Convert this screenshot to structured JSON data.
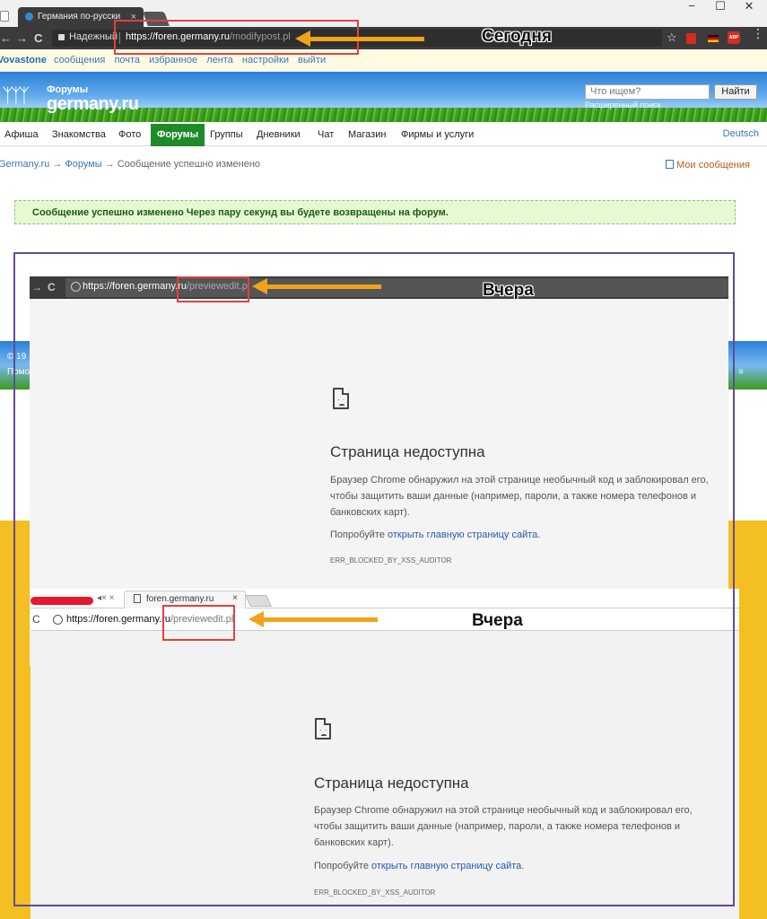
{
  "browser": {
    "tab_title": "Германия по-русски",
    "tab_close": "×",
    "win_controls": [
      "−",
      "☐",
      "✕"
    ],
    "nav": [
      "←",
      "→",
      "C"
    ],
    "secure_label": "Надежный",
    "url_host": "https://foren.germany.ru",
    "url_path": "/modifypost.pl",
    "star": "☆",
    "abp": "ABP",
    "menu": "⋮"
  },
  "site": {
    "username": "Vovastone",
    "userlinks": [
      "сообщения",
      "почта",
      "избранное",
      "лента",
      "настройки",
      "выйти"
    ],
    "logo_top": "Форумы",
    "logo_main": "germany.ru",
    "search_placeholder": "Что ищем?",
    "search_button": "Найти",
    "advanced_search": "Расширенный поиск",
    "nav": [
      "Афиша",
      "Знакомства",
      "Фото",
      "Форумы",
      "Группы",
      "Дневники",
      "Чат",
      "Магазин",
      "Фирмы и услуги"
    ],
    "nav_lang": "Deutsch",
    "breadcrumb": {
      "home": "Germany.ru",
      "sep": " → ",
      "forums": "Форумы",
      "current": "Сообщение успешно изменено"
    },
    "my_messages": "Мои сообщения",
    "success_message": "Сообщение успешно изменено Через пару секунд вы будете возвращены на форум.",
    "footer_fragment_1": "© 19",
    "footer_fragment_2": "Помо"
  },
  "annotations": {
    "today": "Сегодня",
    "yesterday": "Вчера"
  },
  "screenshot1": {
    "nav": [
      "→",
      "C"
    ],
    "url_host": "https://foren.germany.ru",
    "url_path": "/previewedit.pl"
  },
  "screenshot2": {
    "tab_controls": "◂× ×",
    "tab_title": "foren.germany.ru",
    "tab_close": "×",
    "reload": "C",
    "url_host": "https://foren.germany.ru",
    "url_path": "/previewedit.pl"
  },
  "error_page": {
    "title": "Страница недоступна",
    "description": "Браузер Chrome обнаружил на этой странице необычный код и заблокировал его, чтобы защитить ваши данные (например, пароли, а также номера телефонов и банковских карт).",
    "try_prefix": "Попробуйте ",
    "try_link": "открыть главную страницу сайта",
    "try_suffix": ".",
    "code": "ERR_BLOCKED_BY_XSS_AUDITOR"
  },
  "colors": {
    "chrome_dark": "#3b3b3b",
    "site_green": "#1f8a2a",
    "success_bg": "#e5f9d2",
    "annotation_red": "#e3413e",
    "annotation_arrow": "#f0a21c",
    "frame_purple": "#63489c",
    "background_yellow": "#f4bf22",
    "link_blue": "#2458b0"
  }
}
